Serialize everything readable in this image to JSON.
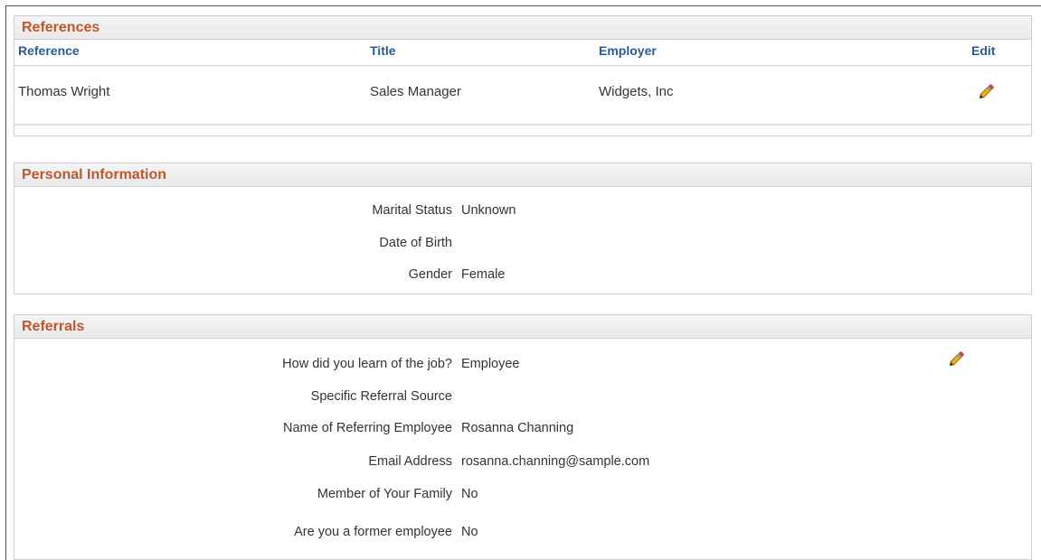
{
  "references": {
    "title": "References",
    "columns": {
      "reference": "Reference",
      "title": "Title",
      "employer": "Employer",
      "edit": "Edit"
    },
    "rows": [
      {
        "reference": "Thomas Wright",
        "title": "Sales Manager",
        "employer": "Widgets, Inc",
        "edit_icon": "pencil-icon"
      }
    ]
  },
  "personal": {
    "title": "Personal Information",
    "fields": [
      {
        "label": "Marital Status",
        "value": "Unknown"
      },
      {
        "label": "Date of Birth",
        "value": ""
      },
      {
        "label": "Gender",
        "value": "Female"
      }
    ]
  },
  "referrals": {
    "title": "Referrals",
    "edit_icon": "pencil-icon",
    "fields": [
      {
        "label": "How did you learn of the job?",
        "value": "Employee"
      },
      {
        "label": "Specific Referral Source",
        "value": ""
      },
      {
        "label": "Name of Referring Employee",
        "value": "Rosanna Channing"
      },
      {
        "label": "Email Address",
        "value": "rosanna.channing@sample.com"
      },
      {
        "label": "Member of Your Family",
        "value": "No"
      },
      {
        "label": "Are you a former employee",
        "value": "No"
      }
    ]
  },
  "colors": {
    "section_title": "#c0572a",
    "column_header": "#2a5d8f"
  }
}
